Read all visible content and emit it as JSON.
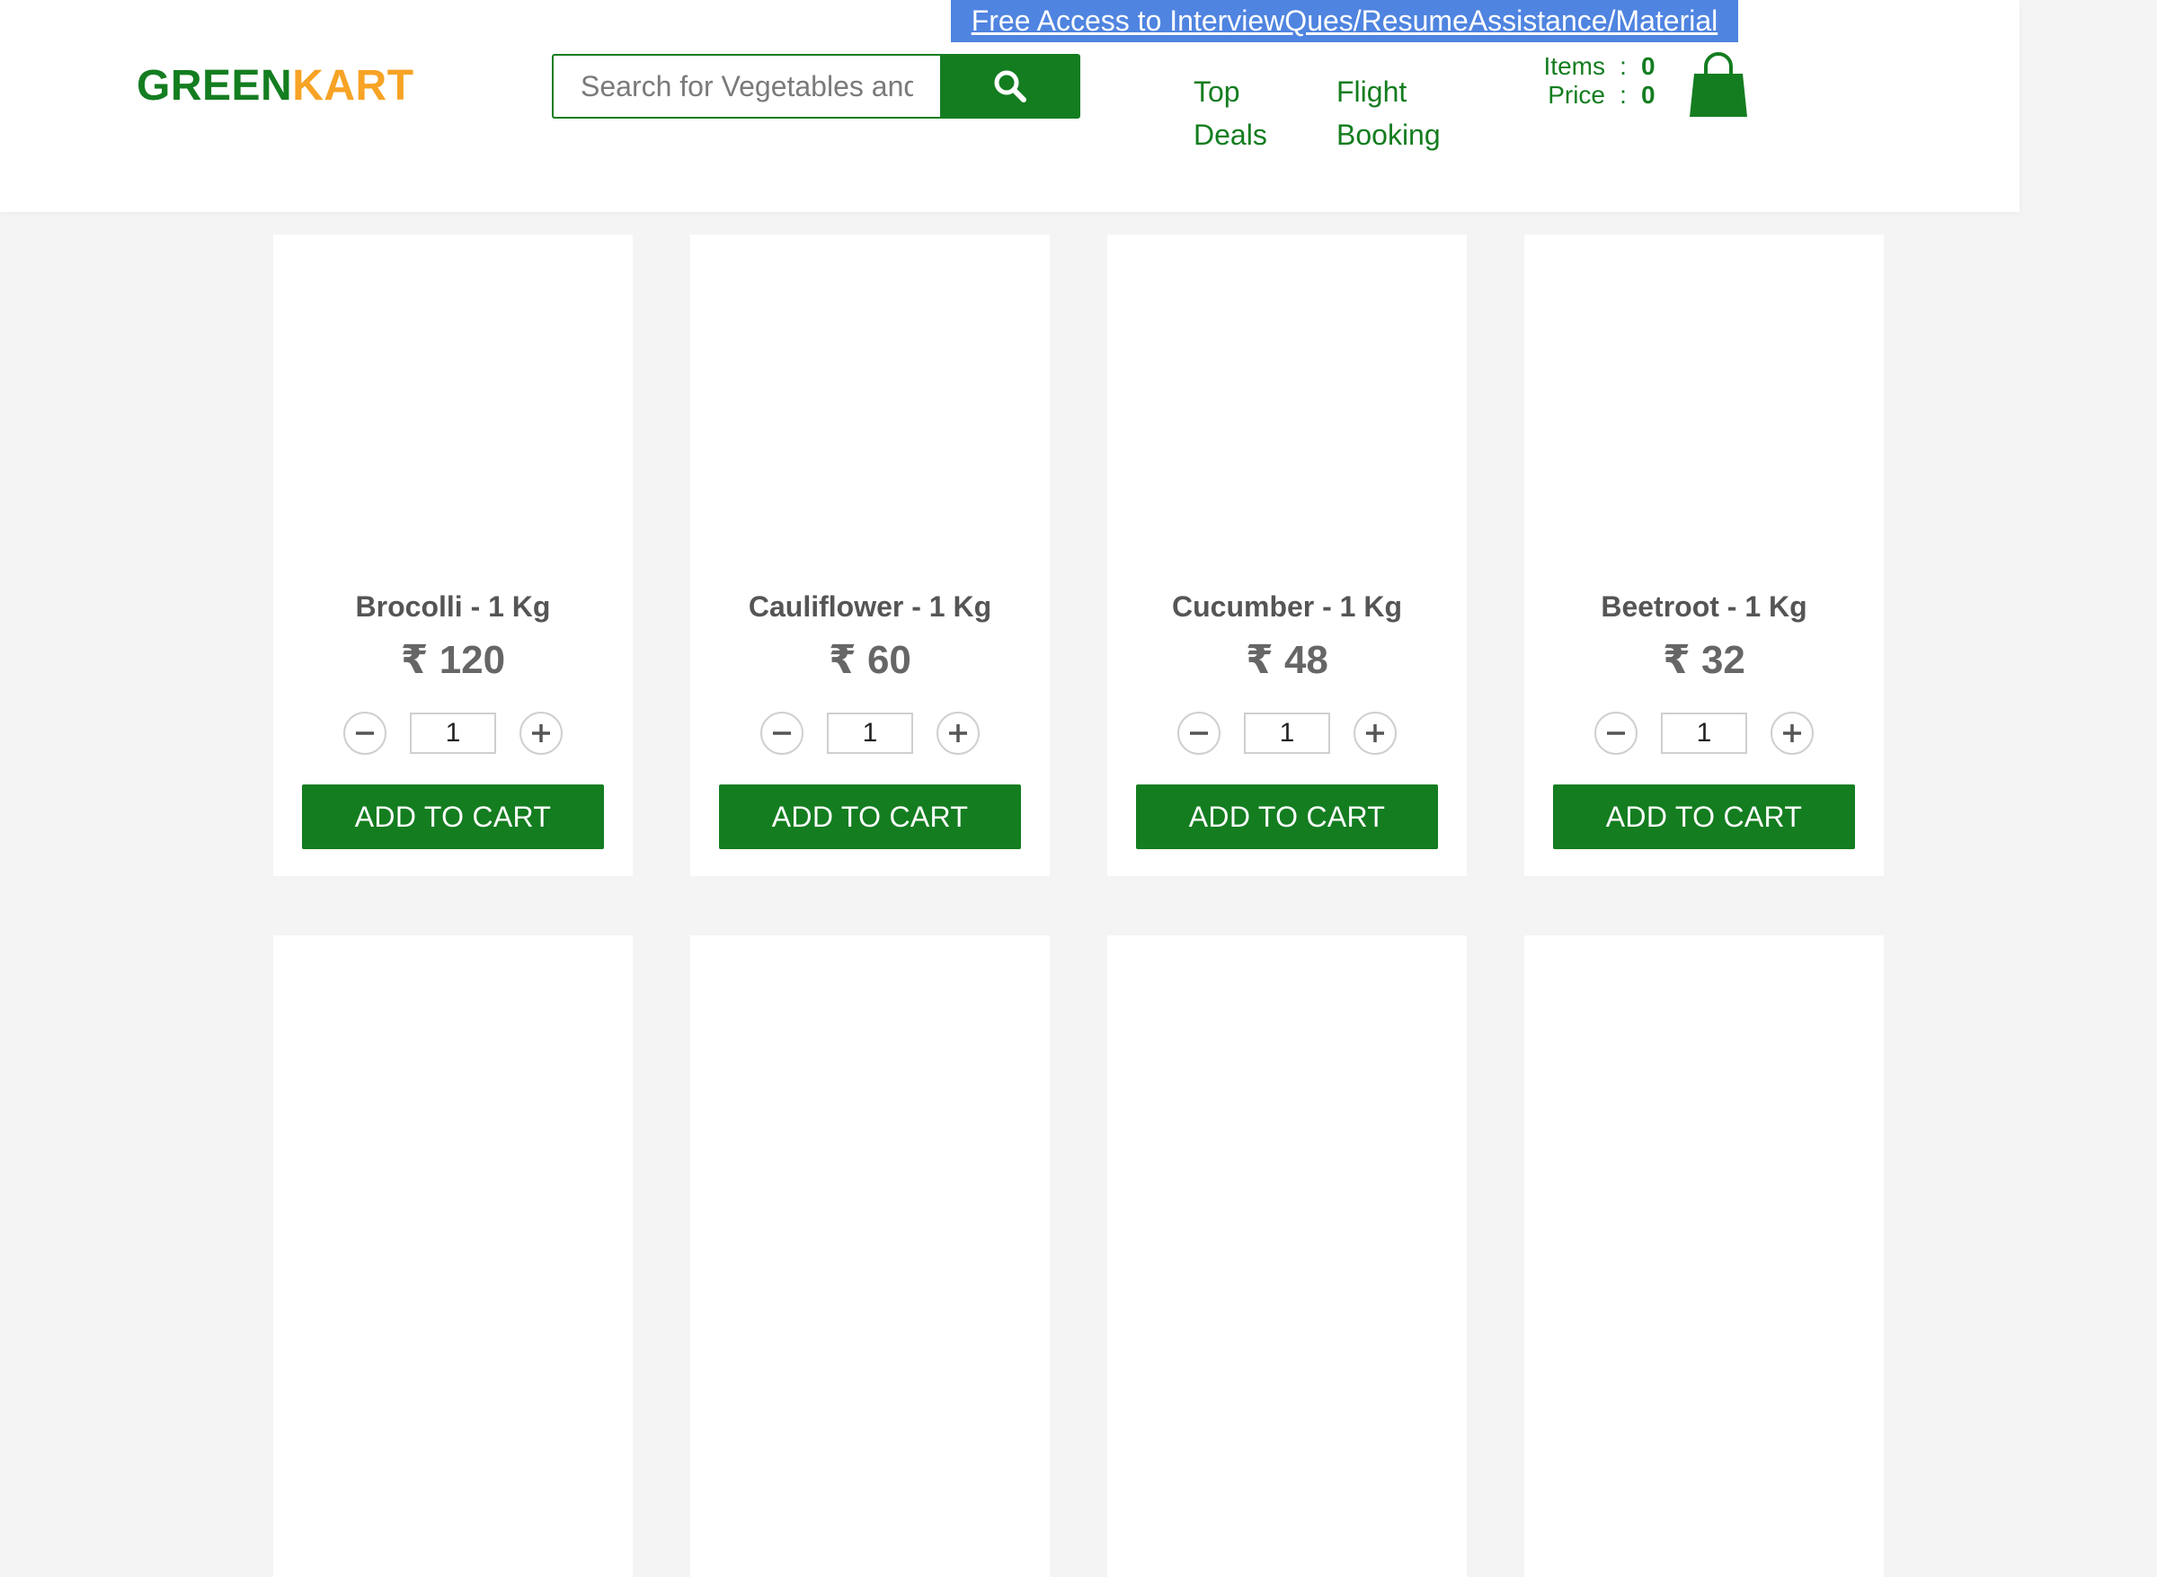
{
  "promo": {
    "link_text": "Free Access to InterviewQues/ResumeAssistance/Material"
  },
  "brand": {
    "green_part": "GREEN",
    "orange_part": "KART"
  },
  "search": {
    "placeholder": "Search for Vegetables and Fruits",
    "icon": "search-icon"
  },
  "nav": [
    {
      "label": "Top Deals"
    },
    {
      "label": "Flight Booking"
    }
  ],
  "cart": {
    "items_label": "Items",
    "items_value": "0",
    "price_label": "Price",
    "price_value": "0",
    "separator": ":",
    "icon": "shopping-bag-icon"
  },
  "products": [
    {
      "name": "Brocolli - 1 Kg",
      "price": "₹ 120",
      "quantity": "1",
      "add_label": "ADD TO CART"
    },
    {
      "name": "Cauliflower - 1 Kg",
      "price": "₹ 60",
      "quantity": "1",
      "add_label": "ADD TO CART"
    },
    {
      "name": "Cucumber - 1 Kg",
      "price": "₹ 48",
      "quantity": "1",
      "add_label": "ADD TO CART"
    },
    {
      "name": "Beetroot - 1 Kg",
      "price": "₹ 32",
      "quantity": "1",
      "add_label": "ADD TO CART"
    },
    {
      "name": "",
      "price": "",
      "quantity": "",
      "add_label": ""
    },
    {
      "name": "",
      "price": "",
      "quantity": "",
      "add_label": ""
    },
    {
      "name": "",
      "price": "",
      "quantity": "",
      "add_label": ""
    },
    {
      "name": "",
      "price": "",
      "quantity": "",
      "add_label": ""
    }
  ],
  "colors": {
    "brand_green": "#147d20",
    "brand_orange": "#f7a325",
    "promo_blue": "#4f84e0",
    "page_background": "#f4f4f4"
  }
}
